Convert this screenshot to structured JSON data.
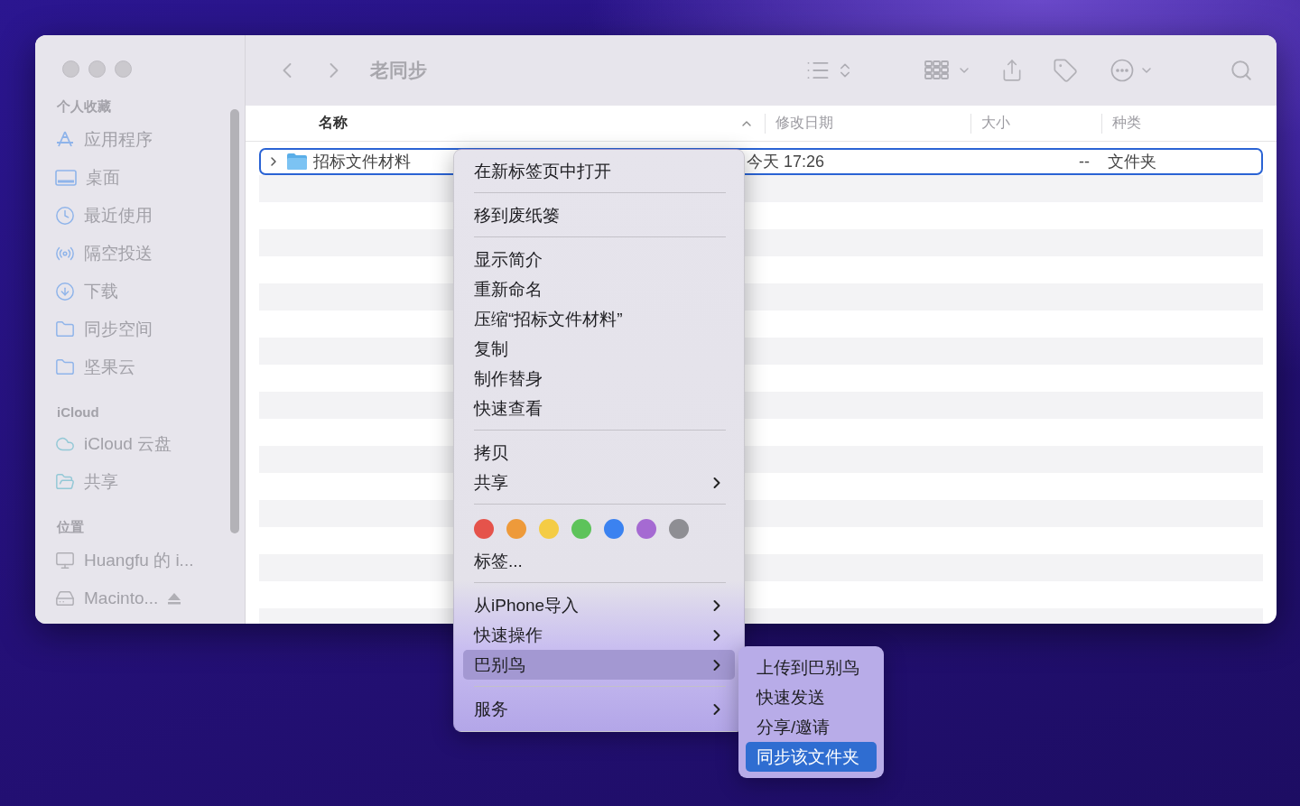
{
  "window": {
    "title": "老同步"
  },
  "sidebar": {
    "sections": [
      {
        "title": "个人收藏",
        "items": [
          {
            "label": "应用程序",
            "kind": "apps"
          },
          {
            "label": "桌面",
            "kind": "desktop"
          },
          {
            "label": "最近使用",
            "kind": "recent"
          },
          {
            "label": "隔空投送",
            "kind": "airdrop"
          },
          {
            "label": "下载",
            "kind": "download"
          },
          {
            "label": "同步空间",
            "kind": "folder"
          },
          {
            "label": "坚果云",
            "kind": "folder"
          }
        ]
      },
      {
        "title": "iCloud",
        "items": [
          {
            "label": "iCloud 云盘",
            "kind": "cloud"
          },
          {
            "label": "共享",
            "kind": "shared"
          }
        ]
      },
      {
        "title": "位置",
        "items": [
          {
            "label": "Huangfu 的 i...",
            "kind": "computer"
          },
          {
            "label": "Macinto...",
            "kind": "disk",
            "ejectable": true
          }
        ]
      }
    ]
  },
  "table": {
    "columns": [
      {
        "label": "名称",
        "sorted": true
      },
      {
        "label": "修改日期",
        "sorted": false
      },
      {
        "label": "大小",
        "sorted": false
      },
      {
        "label": "种类",
        "sorted": false
      }
    ],
    "rows": [
      {
        "name": "招标文件材料",
        "modified": "今天 17:26",
        "size": "--",
        "kind": "文件夹",
        "selected": true,
        "expanded": false
      }
    ]
  },
  "context_menu": {
    "items": [
      {
        "kind": "item",
        "label": "在新标签页中打开",
        "submenu": false,
        "selected": false
      },
      {
        "kind": "separator"
      },
      {
        "kind": "item",
        "label": "移到废纸篓",
        "submenu": false,
        "selected": false
      },
      {
        "kind": "separator"
      },
      {
        "kind": "item",
        "label": "显示简介",
        "submenu": false,
        "selected": false
      },
      {
        "kind": "item",
        "label": "重新命名",
        "submenu": false,
        "selected": false
      },
      {
        "kind": "item",
        "label": "压缩“招标文件材料”",
        "submenu": false,
        "selected": false
      },
      {
        "kind": "item",
        "label": "复制",
        "submenu": false,
        "selected": false
      },
      {
        "kind": "item",
        "label": "制作替身",
        "submenu": false,
        "selected": false
      },
      {
        "kind": "item",
        "label": "快速查看",
        "submenu": false,
        "selected": false
      },
      {
        "kind": "separator"
      },
      {
        "kind": "item",
        "label": "拷贝",
        "submenu": false,
        "selected": false
      },
      {
        "kind": "item",
        "label": "共享",
        "submenu": true,
        "selected": false
      },
      {
        "kind": "separator"
      },
      {
        "kind": "tags",
        "colors": [
          {
            "color": "#e5534b"
          },
          {
            "color": "#ee9a3a"
          },
          {
            "color": "#f4cc45"
          },
          {
            "color": "#5dc35a"
          },
          {
            "color": "#3b82f0"
          },
          {
            "color": "#a56ad2"
          },
          {
            "color": "#8e8e93"
          }
        ]
      },
      {
        "kind": "item",
        "label": "标签...",
        "submenu": false,
        "selected": false
      },
      {
        "kind": "separator"
      },
      {
        "kind": "item",
        "label": "从iPhone导入",
        "submenu": true,
        "selected": false
      },
      {
        "kind": "item",
        "label": "快速操作",
        "submenu": true,
        "selected": false
      },
      {
        "kind": "item",
        "label": "巴别鸟",
        "submenu": true,
        "selected": true
      },
      {
        "kind": "separator"
      },
      {
        "kind": "item",
        "label": "服务",
        "submenu": true,
        "selected": false
      }
    ]
  },
  "submenu": {
    "items": [
      {
        "label": "上传到巴别鸟",
        "selected": false
      },
      {
        "label": "快速发送",
        "selected": false
      },
      {
        "label": "分享/邀请",
        "selected": false
      },
      {
        "label": "同步该文件夹",
        "selected": true
      }
    ]
  }
}
